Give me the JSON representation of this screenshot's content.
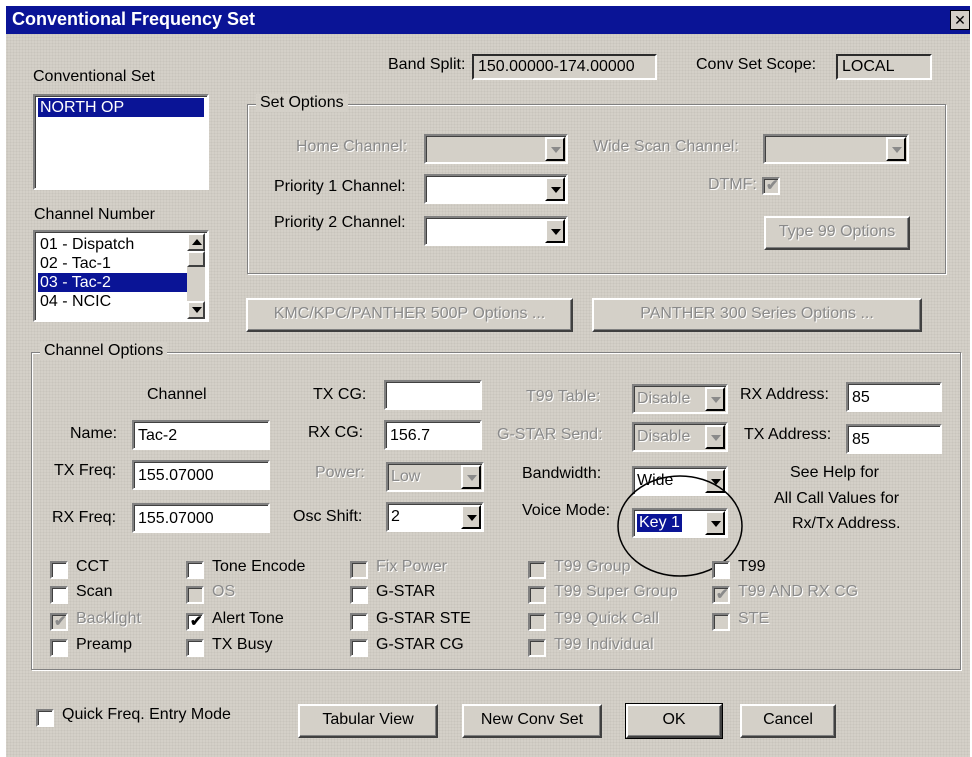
{
  "window": {
    "title": "Conventional Frequency Set",
    "close_glyph": "✕"
  },
  "header": {
    "conventional_set_label": "Conventional Set",
    "band_split_label": "Band Split:",
    "band_split_value": "150.00000-174.00000",
    "scope_label": "Conv Set Scope:",
    "scope_value": "LOCAL"
  },
  "conventional_set_list": [
    "NORTH OP"
  ],
  "channel_number_label": "Channel Number",
  "channel_list": [
    {
      "label": "01  - Dispatch",
      "selected": false
    },
    {
      "label": "02  - Tac-1",
      "selected": false
    },
    {
      "label": "03  - Tac-2",
      "selected": true
    },
    {
      "label": "04  - NCIC",
      "selected": false
    }
  ],
  "set_options": {
    "title": "Set Options",
    "home_channel_label": "Home Channel:",
    "priority1_label": "Priority 1 Channel:",
    "priority2_label": "Priority 2 Channel:",
    "wide_scan_label": "Wide Scan Channel:",
    "dtmf_label": "DTMF:",
    "type99_button": "Type 99 Options"
  },
  "buttons_mid": {
    "kmc": "KMC/KPC/PANTHER 500P Options ...",
    "panther300": "PANTHER 300 Series Options ..."
  },
  "channel_options": {
    "title": "Channel Options",
    "channel_label": "Channel",
    "name_label": "Name:",
    "name_value": "Tac-2",
    "tx_freq_label": "TX Freq:",
    "tx_freq_value": "155.07000",
    "rx_freq_label": "RX Freq:",
    "rx_freq_value": "155.07000",
    "tx_cg_label": "TX CG:",
    "tx_cg_value": "",
    "rx_cg_label": "RX CG:",
    "rx_cg_value": "156.7",
    "power_label": "Power:",
    "power_value": "Low",
    "osc_shift_label": "Osc Shift:",
    "osc_shift_value": "2",
    "t99_table_label": "T99 Table:",
    "t99_table_value": "Disable",
    "gstar_send_label": "G-STAR Send:",
    "gstar_send_value": "Disable",
    "bandwidth_label": "Bandwidth:",
    "bandwidth_value": "Wide",
    "voice_mode_label": "Voice Mode:",
    "voice_mode_value": "Key 1",
    "rx_address_label": "RX Address:",
    "rx_address_value": "85",
    "tx_address_label": "TX Address:",
    "tx_address_value": "85",
    "help_line1": "See Help for",
    "help_line2": "All Call Values for",
    "help_line3": "Rx/Tx Address."
  },
  "checkboxes": {
    "cct": "CCT",
    "scan": "Scan",
    "backlight": "Backlight",
    "preamp": "Preamp",
    "tone_encode": "Tone Encode",
    "os": "OS",
    "alert_tone": "Alert Tone",
    "tx_busy": "TX Busy",
    "fix_power": "Fix Power",
    "gstar": "G-STAR",
    "gstar_ste": "G-STAR STE",
    "gstar_cg": "G-STAR CG",
    "t99_group": "T99 Group",
    "t99_super_group": "T99 Super Group",
    "t99_quick_call": "T99 Quick Call",
    "t99_individual": "T99 Individual",
    "t99": "T99",
    "t99_and_rx_cg": "T99 AND RX CG",
    "ste": "STE",
    "quick_freq": "Quick Freq. Entry Mode"
  },
  "check_mark": "✔",
  "footer": {
    "tabular_view": "Tabular View",
    "new_conv_set": "New Conv Set",
    "ok": "OK",
    "cancel": "Cancel"
  },
  "colors": {
    "title_bar": "#0a1496",
    "face": "#d4d0c8",
    "selection": "#0a1496"
  }
}
